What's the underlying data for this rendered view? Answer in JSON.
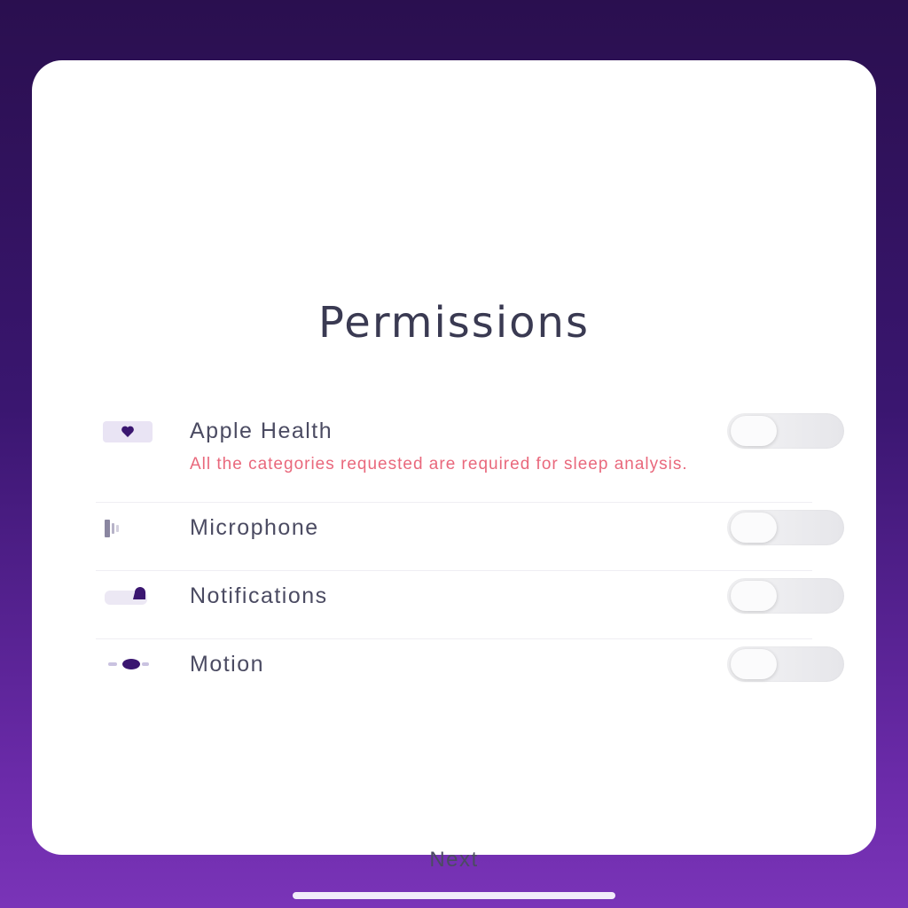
{
  "title": "Permissions",
  "permissions": [
    {
      "label": "Apple Health",
      "note": "All the categories requested are required for sleep analysis.",
      "icon": "heart-icon",
      "enabled": false
    },
    {
      "label": "Microphone",
      "note": "",
      "icon": "microphone-icon",
      "enabled": false
    },
    {
      "label": "Notifications",
      "note": "",
      "icon": "bell-icon",
      "enabled": false
    },
    {
      "label": "Motion",
      "note": "",
      "icon": "motion-icon",
      "enabled": false
    }
  ],
  "next_label": "Next",
  "colors": {
    "accent": "#3a1670",
    "warning_text": "#e9687c",
    "background_top": "#2a0f4f",
    "background_bottom": "#7a34b8"
  }
}
